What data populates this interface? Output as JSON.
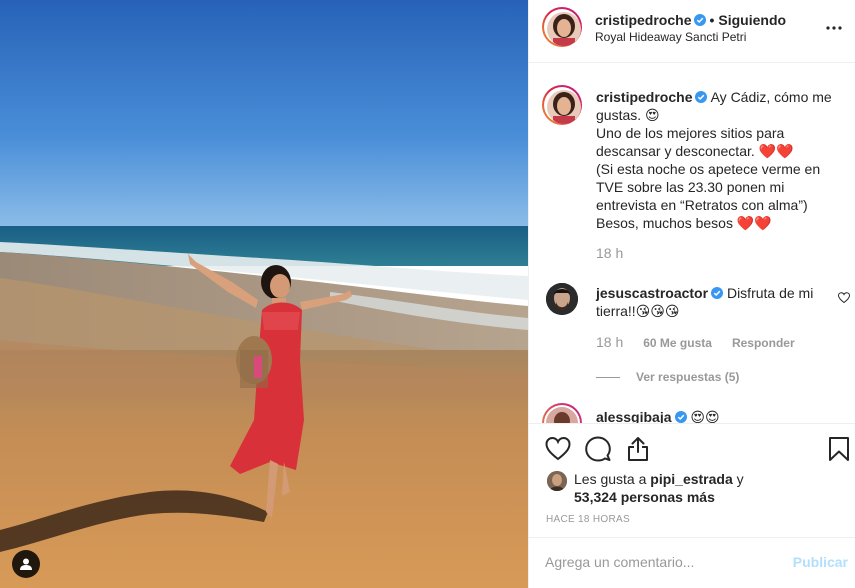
{
  "post": {
    "username": "cristipedroche",
    "separator": "•",
    "following_label": "Siguiendo",
    "location": "Royal Hideaway Sancti Petri"
  },
  "caption": {
    "username": "cristipedroche",
    "text": " Ay Cádiz, cómo me gustas. 😍\nUno de los mejores sitios para descansar y desconectar. ❤️❤️\n(Si esta noche os apetece verme en TVE sobre las 23.30 ponen mi entrevista en “Retratos con alma”)\nBesos, muchos besos ❤️❤️",
    "time": "18 h"
  },
  "comments": [
    {
      "username": "jesuscastroactor",
      "text": " Disfruta de mi tierra!!😘😘😘",
      "time": "18 h",
      "likes": "60 Me gusta",
      "reply_label": "Responder",
      "view_replies": "Ver respuestas (5)"
    },
    {
      "username": "alessgibaja",
      "text": "😍😍"
    }
  ],
  "likes": {
    "prefix": "Les gusta a ",
    "user": "pipi_estrada",
    "joiner": " y",
    "count": "53,324 personas más"
  },
  "timestamp": "HACE 18 HORAS",
  "comment_box": {
    "placeholder": "Agrega un comentario...",
    "post_label": "Publicar"
  },
  "colors": {
    "verified": "#3897f0",
    "dress": "#d8313a",
    "sea": "#1f6f8b",
    "sky_top": "#2d6dbf",
    "sand": "#c88f55",
    "post_disabled": "#b2dffc"
  },
  "icons": [
    "heart-icon",
    "comment-icon",
    "share-icon",
    "bookmark-icon",
    "more-icon",
    "verified-badge-icon",
    "user-tag-icon"
  ]
}
